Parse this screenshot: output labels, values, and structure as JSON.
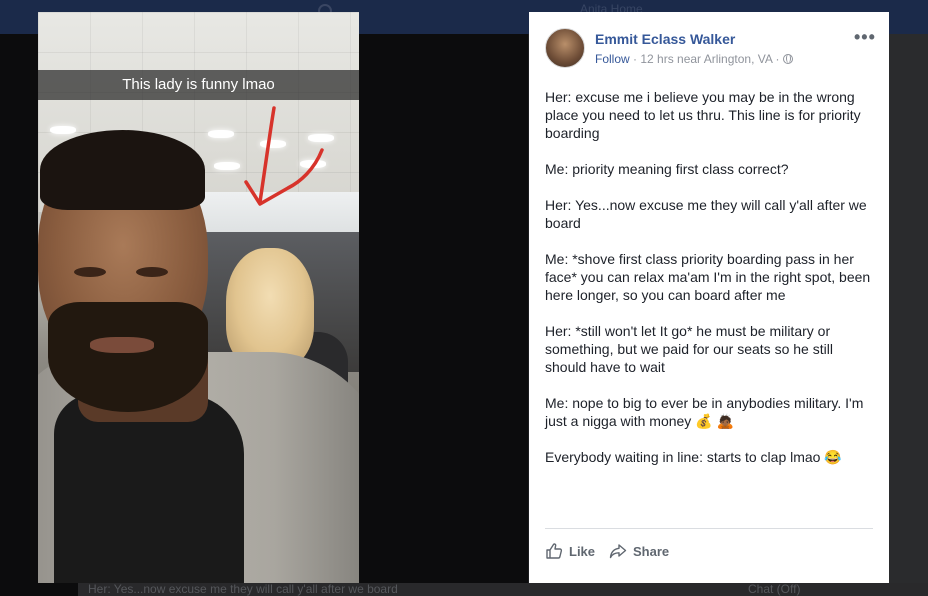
{
  "background": {
    "nav_text": "Anita   Home",
    "footer_text": "Her: Yes...now excuse me they will call y'all after we board",
    "chat_label": "Chat (Off)"
  },
  "photo": {
    "caption": "This lady is funny lmao",
    "arrow_color": "#d7332b"
  },
  "post": {
    "author": "Emmit Eclass Walker",
    "follow_label": "Follow",
    "meta_text": " · 12 hrs near Arlington, VA · ",
    "more_icon": "more-horizontal-icon",
    "paragraphs": [
      "Her: excuse me i believe you may be in the wrong place you need to let us thru. This line is for priority boarding",
      "Me: priority meaning first class correct?",
      "Her: Yes...now excuse me they will call y'all after we board",
      "Me: *shove first class priority boarding pass in her face* you can relax ma'am I'm in the right spot, been here longer, so you can board after me",
      "Her: *still won't let It go* he must be military or something, but we paid for our seats so he still should have to wait",
      "Me: nope to big to ever be in anybodies military. I'm just a nigga with money 💰 🙇🏾",
      "Everybody waiting in line: starts to clap lmao 😂"
    ],
    "actions": {
      "like_label": "Like",
      "share_label": "Share"
    }
  }
}
